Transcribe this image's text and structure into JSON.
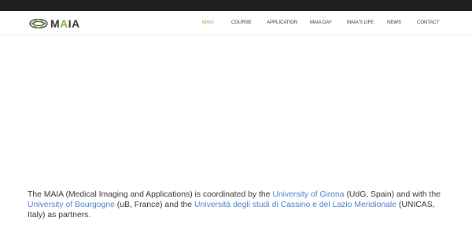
{
  "logo": {
    "text_part1": "M",
    "text_accent": "A",
    "text_part2": "IA"
  },
  "nav": {
    "items": [
      {
        "label": "MAIA",
        "active": true
      },
      {
        "label": "COURSE",
        "active": false
      },
      {
        "label": "APPLICATION",
        "active": false
      },
      {
        "label": "MAIA DAY",
        "active": false
      },
      {
        "label": "MAIA'S LIFE",
        "active": false
      },
      {
        "label": "NEWS",
        "active": false
      },
      {
        "label": "CONTACT",
        "active": false
      }
    ]
  },
  "content": {
    "p1": "The MAIA (Medical Imaging and Applications) is coordinated by the ",
    "link_girona": "University of Girona",
    "p2": " (UdG, Spain) and with the ",
    "link_bourgogne": "University of Bourgogne",
    "p3": " (uB, France) and the ",
    "link_cassino": "Università degli studi di Cassino e del Lazio Meridionale",
    "p4": " (UNICAS, Italy) as partners."
  },
  "colors": {
    "accent": "#7ab648",
    "link": "#4a7fd0",
    "topbar": "#1e1e1e",
    "text": "#333333"
  }
}
